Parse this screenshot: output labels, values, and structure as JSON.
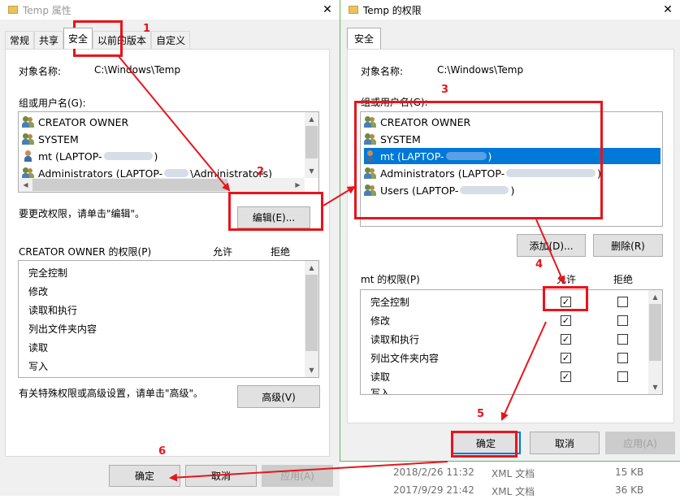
{
  "w1": {
    "title": "Temp 属性",
    "tabs": [
      "常规",
      "共享",
      "安全",
      "以前的版本",
      "自定义"
    ],
    "object_label": "对象名称:",
    "object_value": "C:\\Windows\\Temp",
    "group_label": "组或用户名(G):",
    "users": [
      {
        "prefix": "CREATOR OWNER",
        "suffix": ""
      },
      {
        "prefix": "SYSTEM",
        "suffix": ""
      },
      {
        "prefix": "mt (LAPTOP-",
        "suffix": ")"
      },
      {
        "prefix": "Administrators (LAPTOP-",
        "suffix": "\\Administrators)"
      }
    ],
    "edit_hint": "要更改权限，请单击\"编辑\"。",
    "edit_btn": "编辑(E)...",
    "perm_label": "CREATOR OWNER 的权限(P)",
    "allow": "允许",
    "deny": "拒绝",
    "perms": [
      "完全控制",
      "修改",
      "读取和执行",
      "列出文件夹内容",
      "读取",
      "写入"
    ],
    "advanced_hint": "有关特殊权限或高级设置，请单击\"高级\"。",
    "advanced_btn": "高级(V)",
    "ok": "确定",
    "cancel": "取消",
    "apply": "应用(A)"
  },
  "w2": {
    "title": "Temp 的权限",
    "tab": "安全",
    "object_label": "对象名称:",
    "object_value": "C:\\Windows\\Temp",
    "group_label": "组或用户名(G):",
    "users": [
      {
        "prefix": "CREATOR OWNER",
        "suffix": ""
      },
      {
        "prefix": "SYSTEM",
        "suffix": ""
      },
      {
        "prefix": "mt (LAPTOP-",
        "suffix": ")"
      },
      {
        "prefix": "Administrators (LAPTOP-",
        "suffix": ")"
      },
      {
        "prefix": "Users (LAPTOP-",
        "suffix": ")"
      }
    ],
    "add_btn": "添加(D)...",
    "remove_btn": "删除(R)",
    "perm_label": "mt 的权限(P)",
    "allow": "允许",
    "deny": "拒绝",
    "perms": [
      "完全控制",
      "修改",
      "读取和执行",
      "列出文件夹内容",
      "读取",
      "写入"
    ],
    "allow_checked": [
      true,
      true,
      true,
      true,
      true,
      true
    ],
    "deny_checked": [
      false,
      false,
      false,
      false,
      false,
      false
    ],
    "ok": "确定",
    "cancel": "取消",
    "apply": "应用(A)"
  },
  "files": [
    {
      "date": "2018/2/26 11:32",
      "type": "XML 文档",
      "size": "15 KB"
    },
    {
      "date": "2017/9/29 21:42",
      "type": "XML 文档",
      "size": "36 KB"
    }
  ],
  "steps": [
    "1",
    "2",
    "3",
    "4",
    "5",
    "6"
  ],
  "colors": {
    "annotation": "#e8141c",
    "selection": "#0078d7",
    "window_border": "#5cb85c"
  },
  "icons": {
    "close": "close-icon",
    "folder": "folder-icon",
    "user": "user-icon",
    "group": "users-icon",
    "check": "check-icon"
  }
}
